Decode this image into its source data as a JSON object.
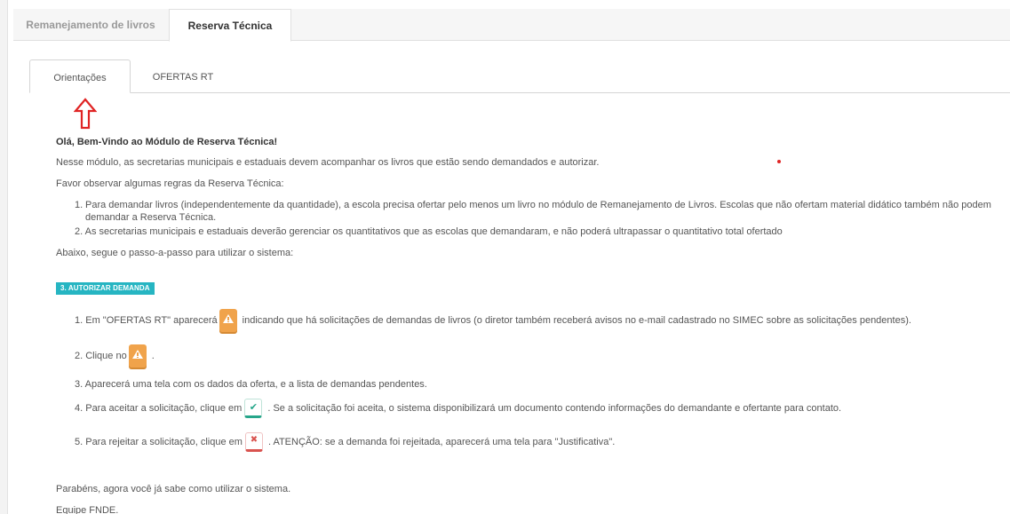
{
  "top_tabs": [
    {
      "label": "Remanejamento de livros"
    },
    {
      "label": "Reserva Técnica"
    }
  ],
  "inner_tabs": [
    {
      "label": "Orientações"
    },
    {
      "label": "OFERTAS RT"
    }
  ],
  "content": {
    "welcome": "Olá, Bem-Vindo ao Módulo de Reserva Técnica!",
    "intro": "Nesse módulo, as secretarias municipais e estaduais devem acompanhar os livros que estão sendo demandados e autorizar.",
    "rules_intro": "Favor observar algumas regras da Reserva Técnica:",
    "rules": [
      "Para demandar livros (independentemente da quantidade), a escola precisa ofertar pelo menos um livro no módulo de Remanejamento de Livros. Escolas que não ofertam material didático também não podem demandar a Reserva Técnica.",
      "As secretarias municipais e estaduais deverão gerenciar os quantitativos que as escolas que demandaram, e não poderá ultrapassar o quantitativo total ofertado"
    ],
    "steps_intro": "Abaixo, segue o passo-a-passo para utilizar o sistema:",
    "badge": "3. AUTORIZAR DEMANDA",
    "steps": {
      "s1_a": "1. Em \"OFERTAS RT\" aparecerá",
      "s1_b": "indicando que há solicitações de demandas de livros (o diretor também receberá avisos no e-mail cadastrado no SIMEC sobre as solicitações pendentes).",
      "s2_a": "2. Clique no",
      "s2_b": ".",
      "s3": "3. Aparecerá uma tela com os dados da oferta, e a lista de demandas pendentes.",
      "s4_a": "4. Para aceitar a solicitação, clique em",
      "s4_b": ". Se a solicitação foi aceita, o sistema disponibilizará um documento contendo informações do demandante e ofertante para contato.",
      "s5_a": "5. Para rejeitar a solicitação, clique em",
      "s5_b": ". ATENÇÃO: se a demanda foi rejeitada, aparecerá uma tela para \"Justificativa\"."
    },
    "congrats": "Parabéns, agora você já sabe como utilizar o sistema.",
    "team": "Equipe FNDE."
  },
  "icons": {
    "warning": "warning-icon",
    "accept": "check-icon",
    "reject": "close-icon",
    "annotation": "red-up-arrow"
  },
  "colors": {
    "badge": "#26b5c2",
    "warning": "#f0a34b",
    "accept": "#26a68a",
    "reject": "#d9534f",
    "arrow": "#e02424"
  }
}
